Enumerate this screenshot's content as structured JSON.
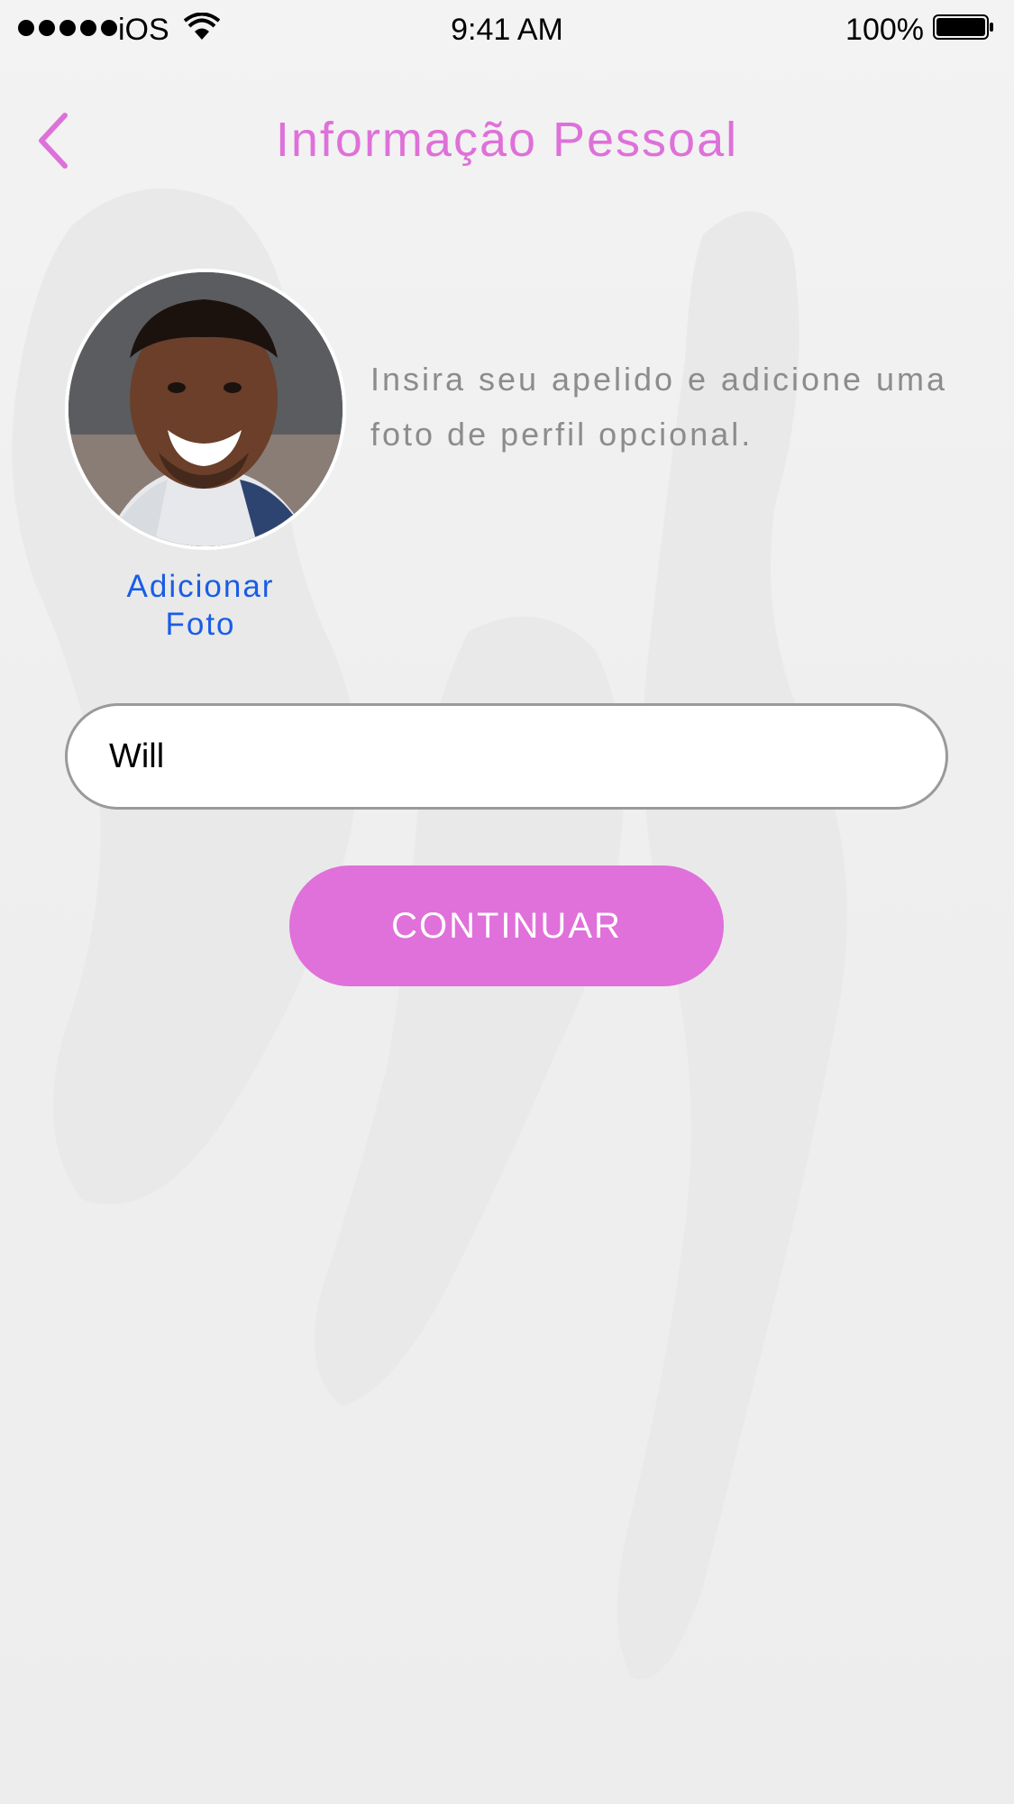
{
  "status_bar": {
    "carrier": "iOS",
    "time": "9:41 AM",
    "battery": "100%"
  },
  "header": {
    "title": "Informação Pessoal",
    "back_icon": "chevron-left-icon"
  },
  "profile": {
    "add_photo_line1": "Adicionar",
    "add_photo_line2": "Foto",
    "description": "Insira seu apelido e adicione uma foto de perfil opcional."
  },
  "form": {
    "nickname_value": "Will"
  },
  "actions": {
    "continue_label": "CONTINUAR"
  },
  "colors": {
    "accent": "#de71d9",
    "link": "#1a5de6",
    "muted_text": "#8c8c8c"
  }
}
